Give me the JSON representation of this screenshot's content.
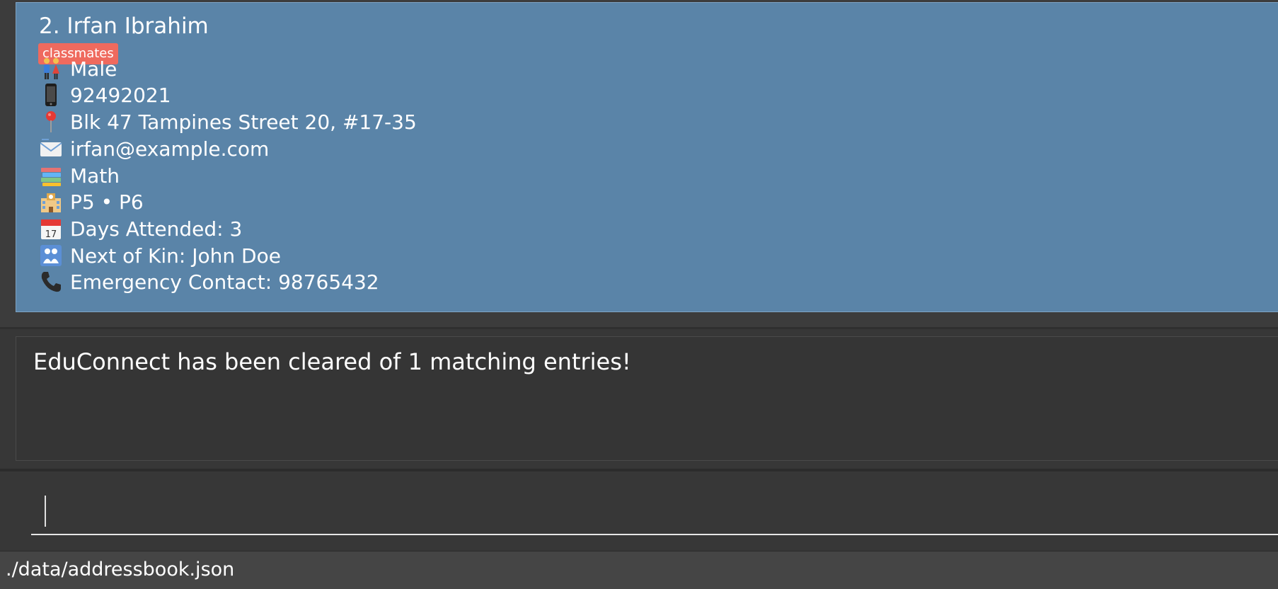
{
  "person": {
    "title": "2. Irfan Ibrahim",
    "tag": "classmates",
    "fields": [
      {
        "icon": "gender-icon",
        "value": "Male"
      },
      {
        "icon": "mobile-phone-icon",
        "value": "92492021"
      },
      {
        "icon": "pin-icon",
        "value": "Blk 47 Tampines Street 20, #17-35"
      },
      {
        "icon": "envelope-icon",
        "value": "irfan@example.com"
      },
      {
        "icon": "books-icon",
        "value": "Math"
      },
      {
        "icon": "school-icon",
        "value": "P5 • P6"
      },
      {
        "icon": "calendar-icon",
        "value": "Days Attended: 3"
      },
      {
        "icon": "people-icon",
        "value": "Next of Kin: John Doe"
      },
      {
        "icon": "telephone-icon",
        "value": "Emergency Contact: 98765432"
      }
    ]
  },
  "result": {
    "message": "EduConnect has been cleared of 1 matching entries!"
  },
  "command": {
    "value": ""
  },
  "status": {
    "file_path": "./data/addressbook.json"
  },
  "colors": {
    "card_background": "#5a84a8",
    "tag_background": "#ef6a5e",
    "app_background": "#373737"
  }
}
